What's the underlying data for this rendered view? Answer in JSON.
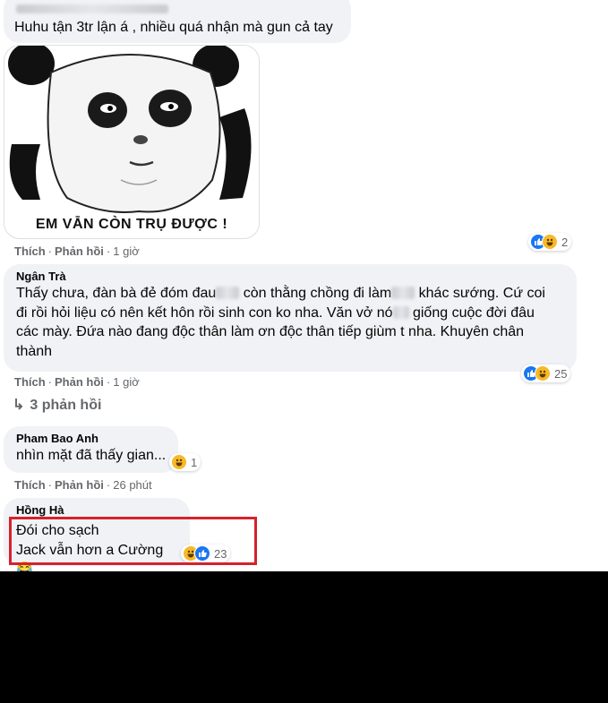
{
  "comments": [
    {
      "author": "",
      "text": "Huhu tận 3tr lận á , nhiều quá nhận mà gun cả tay"
    },
    {
      "sticker_caption": "EM VẪN CÒN TRỤ ĐƯỢC !",
      "actions": {
        "like": "Thích",
        "reply": "Phản hồi",
        "time": "1 giờ"
      },
      "reactions": {
        "count": "2",
        "icons": [
          "like-icon",
          "haha-icon"
        ]
      }
    },
    {
      "author": "Ngân Trà",
      "lines": [
        "Thấy chưa, đàn bà đẻ đóm đau",
        " còn thằng chồng đi làm",
        " khác sướng. Cứ coi",
        "đi rồi hỏi liệu có nên kết hôn rồi sinh con ko nha. Văn vở nó",
        " giống cuộc đời đâu",
        "các mày. Đứa nào đang độc thân làm ơn độc thân tiếp giùm t nha. Khuyên chân",
        "thành"
      ],
      "actions": {
        "like": "Thích",
        "reply": "Phản hồi",
        "time": "1 giờ"
      },
      "reactions": {
        "count": "25",
        "icons": [
          "like-icon",
          "haha-icon"
        ]
      },
      "replies_link": "3 phản hồi"
    },
    {
      "author": "Pham Bao Anh",
      "text": "nhìn mặt đã thấy gian...",
      "actions": {
        "like": "Thích",
        "reply": "Phản hồi",
        "time": "26 phút"
      },
      "reactions": {
        "count": "1",
        "icons": [
          "haha-icon"
        ]
      }
    },
    {
      "author": "Hồng Hà",
      "lines": [
        "Đói cho sạch",
        "Jack vẫn hơn a Cường"
      ],
      "emoji": "😂",
      "reactions": {
        "count": "23",
        "icons": [
          "haha-icon",
          "like-icon"
        ]
      }
    }
  ],
  "colors": {
    "bubble": "#f0f2f5",
    "meta": "#65676b",
    "highlight": "#d7212c",
    "like": "#1877f2",
    "haha": "#f7b928"
  }
}
